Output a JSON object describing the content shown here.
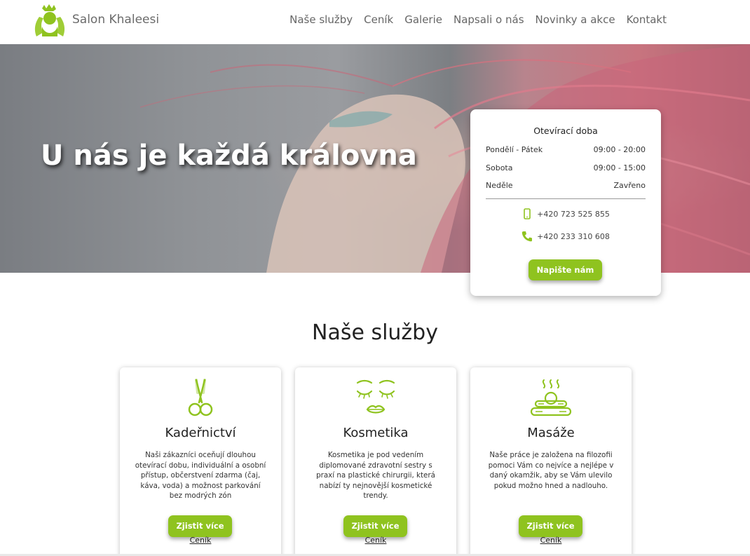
{
  "brand": {
    "name": "Salon Khaleesi",
    "accent": "#8fc31f"
  },
  "nav": [
    {
      "label": "Naše služby"
    },
    {
      "label": "Ceník"
    },
    {
      "label": "Galerie"
    },
    {
      "label": "Napsali o nás"
    },
    {
      "label": "Novinky a akce"
    },
    {
      "label": "Kontakt"
    }
  ],
  "hero": {
    "title": "U nás je každá královna"
  },
  "hours": {
    "title": "Otevírací doba",
    "rows": [
      {
        "day": "Pondělí - Pátek",
        "time": "09:00 - 20:00"
      },
      {
        "day": "Sobota",
        "time": "09:00 - 15:00"
      },
      {
        "day": "Neděle",
        "time": "Zavřeno"
      }
    ],
    "mobile": "+420 723 525 855",
    "phone": "+420 233 310 608",
    "button": "Napište nám"
  },
  "services": {
    "title": "Naše služby",
    "items": [
      {
        "icon": "scissors-icon",
        "title": "Kadeřnictví",
        "text": "Naši zákazníci oceňují dlouhou otevírací dobu, individuální a osobní přístup, občerstvení zdarma (čaj, káva, voda) a možnost parkování bez modrých zón",
        "button": "Zjistit více",
        "link": "Ceník"
      },
      {
        "icon": "face-icon",
        "title": "Kosmetika",
        "text": "Kosmetika je pod vedením diplomované zdravotní sestry s praxí na plastické chirurgii, která nabízí ty nejnovější kosmetické trendy.",
        "button": "Zjistit více",
        "link": "Ceník"
      },
      {
        "icon": "massage-stones-icon",
        "title": "Masáže",
        "text": "Naše práce je založena na filozofii pomoci Vám co nejvíce a nejlépe v daný okamžik, aby se Vám ulevilo pokud možno hned a nadlouho.",
        "button": "Zjistit více",
        "link": "Ceník"
      }
    ]
  }
}
